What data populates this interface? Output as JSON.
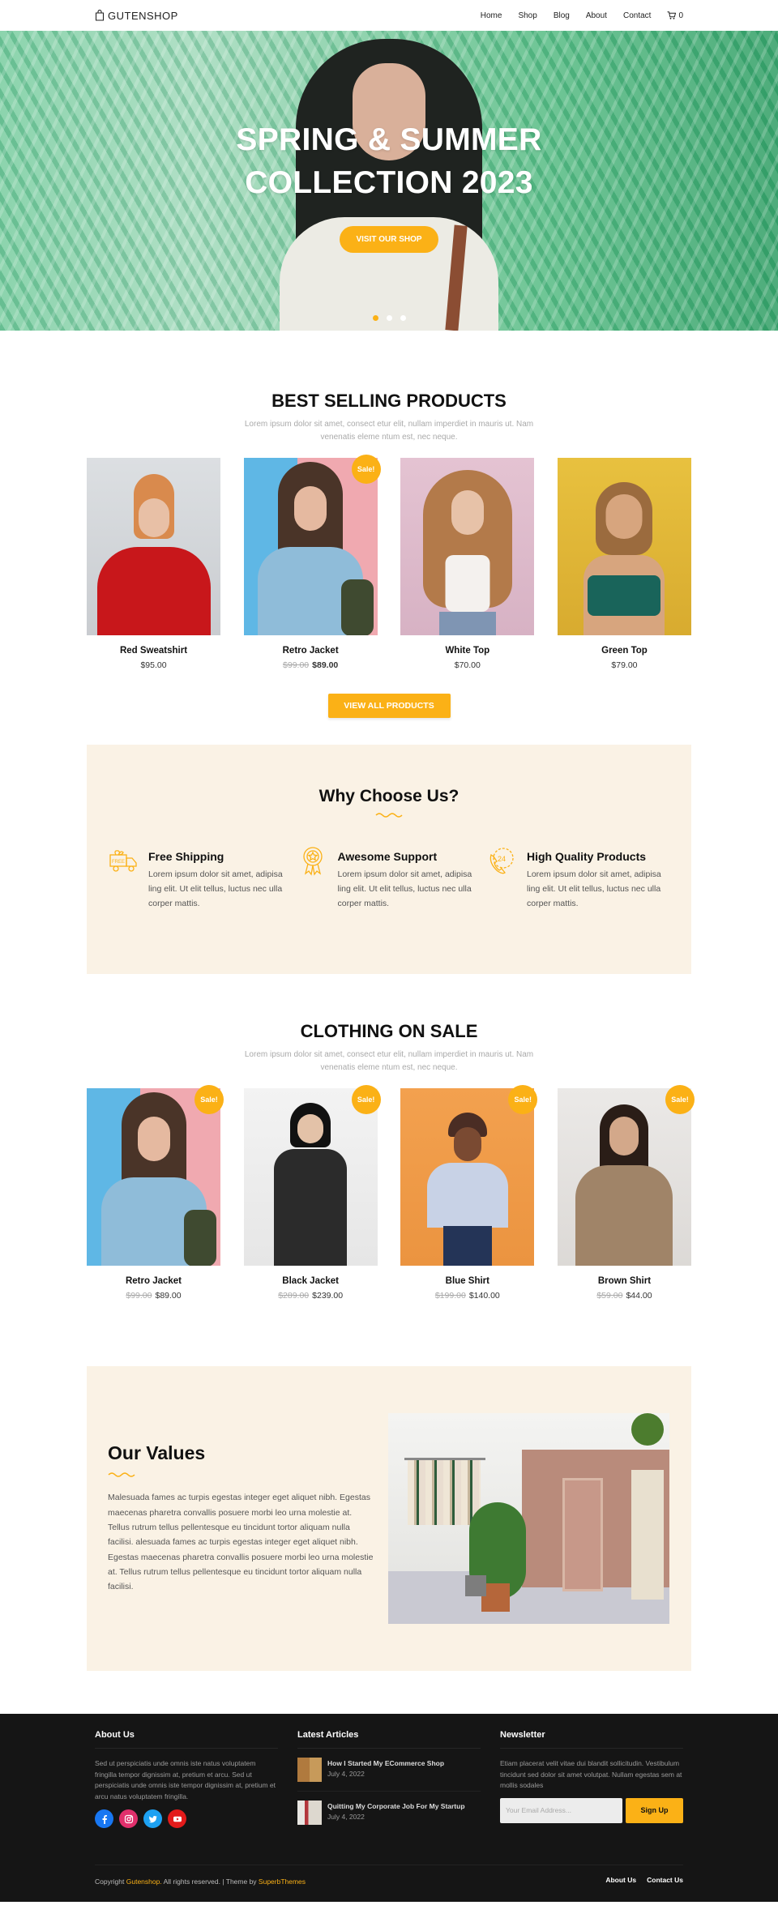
{
  "header": {
    "logo": "GUTENSHOP",
    "nav": [
      "Home",
      "Shop",
      "Blog",
      "About",
      "Contact"
    ],
    "cart_count": "0"
  },
  "hero": {
    "title_line1": "SPRING & SUMMER",
    "title_line2": "COLLECTION 2023",
    "button": "VISIT OUR SHOP",
    "slides": 3,
    "active_slide": 1
  },
  "best_selling": {
    "title": "BEST SELLING PRODUCTS",
    "subtitle": "Lorem ipsum dolor sit amet, consect etur elit, nullam imperdiet in mauris ut. Nam venenatis eleme ntum est, nec neque.",
    "products": [
      {
        "name": "Red Sweatshirt",
        "price": "$95.00",
        "old_price": "",
        "sale": false
      },
      {
        "name": "Retro Jacket",
        "price": "$89.00",
        "old_price": "$99.00",
        "sale": true
      },
      {
        "name": "White Top",
        "price": "$70.00",
        "old_price": "",
        "sale": false
      },
      {
        "name": "Green Top",
        "price": "$79.00",
        "old_price": "",
        "sale": false
      }
    ],
    "view_all": "VIEW ALL PRODUCTS",
    "sale_badge": "Sale!"
  },
  "why": {
    "title": "Why Choose Us?",
    "features": [
      {
        "icon": "free-shipping-truck-icon",
        "title": "Free Shipping",
        "text": "Lorem ipsum dolor sit amet, adipisa ling elit. Ut elit tellus, luctus nec ulla corper mattis."
      },
      {
        "icon": "award-ribbon-icon",
        "title": "Awesome Support",
        "text": "Lorem ipsum dolor sit amet, adipisa ling elit. Ut elit tellus, luctus nec ulla corper mattis."
      },
      {
        "icon": "24h-phone-icon",
        "title": "High Quality Products",
        "text": "Lorem ipsum dolor sit amet, adipisa ling elit. Ut elit tellus, luctus nec ulla corper mattis."
      }
    ]
  },
  "on_sale": {
    "title": "CLOTHING ON SALE",
    "subtitle": "Lorem ipsum dolor sit amet, consect etur elit, nullam imperdiet in mauris ut. Nam venenatis eleme ntum est, nec neque.",
    "products": [
      {
        "name": "Retro Jacket",
        "price": "$89.00",
        "old_price": "$99.00",
        "sale": true
      },
      {
        "name": "Black Jacket",
        "price": "$239.00",
        "old_price": "$289.00",
        "sale": true
      },
      {
        "name": "Blue Shirt",
        "price": "$140.00",
        "old_price": "$199.00",
        "sale": true
      },
      {
        "name": "Brown Shirt",
        "price": "$44.00",
        "old_price": "$59.00",
        "sale": true
      }
    ],
    "sale_badge": "Sale!"
  },
  "values": {
    "title": "Our Values",
    "body": "Malesuada fames ac turpis egestas integer eget aliquet nibh. Egestas maecenas pharetra convallis posuere morbi leo urna molestie at. Tellus rutrum tellus pellentesque eu tincidunt tortor aliquam nulla facilisi. alesuada fames ac turpis egestas integer eget aliquet nibh. Egestas maecenas pharetra convallis posuere morbi leo urna molestie at. Tellus rutrum tellus pellentesque eu tincidunt tortor aliquam nulla facilisi."
  },
  "footer": {
    "about": {
      "title": "About Us",
      "text": "Sed ut perspiciatis unde omnis iste natus voluptatem fringilla tempor dignissim at, pretium et arcu. Sed ut perspiciatis unde omnis iste tempor dignissim at, pretium et arcu natus voluptatem fringilla."
    },
    "articles": {
      "title": "Latest Articles",
      "items": [
        {
          "title": "How I Started My ECommerce Shop",
          "date": "July 4, 2022"
        },
        {
          "title": "Quitting My Corporate Job For My Startup",
          "date": "July 4, 2022"
        }
      ]
    },
    "newsletter": {
      "title": "Newsletter",
      "text": "Etiam placerat velit vitae dui blandit sollicitudin. Vestibulum tincidunt sed dolor sit amet volutpat. Nullam egestas sem at mollis sodales",
      "placeholder": "Your Email Address...",
      "button": "Sign Up"
    },
    "copyright_prefix": "Copyright ",
    "copyright_brand": "Gutenshop.",
    "copyright_mid": " All rights reserved. | Theme by ",
    "copyright_theme": "SuperbThemes",
    "links": [
      "About Us",
      "Contact Us"
    ]
  },
  "colors": {
    "accent": "#fbb116",
    "cream": "#faf2e5",
    "footer_bg": "#151515"
  }
}
